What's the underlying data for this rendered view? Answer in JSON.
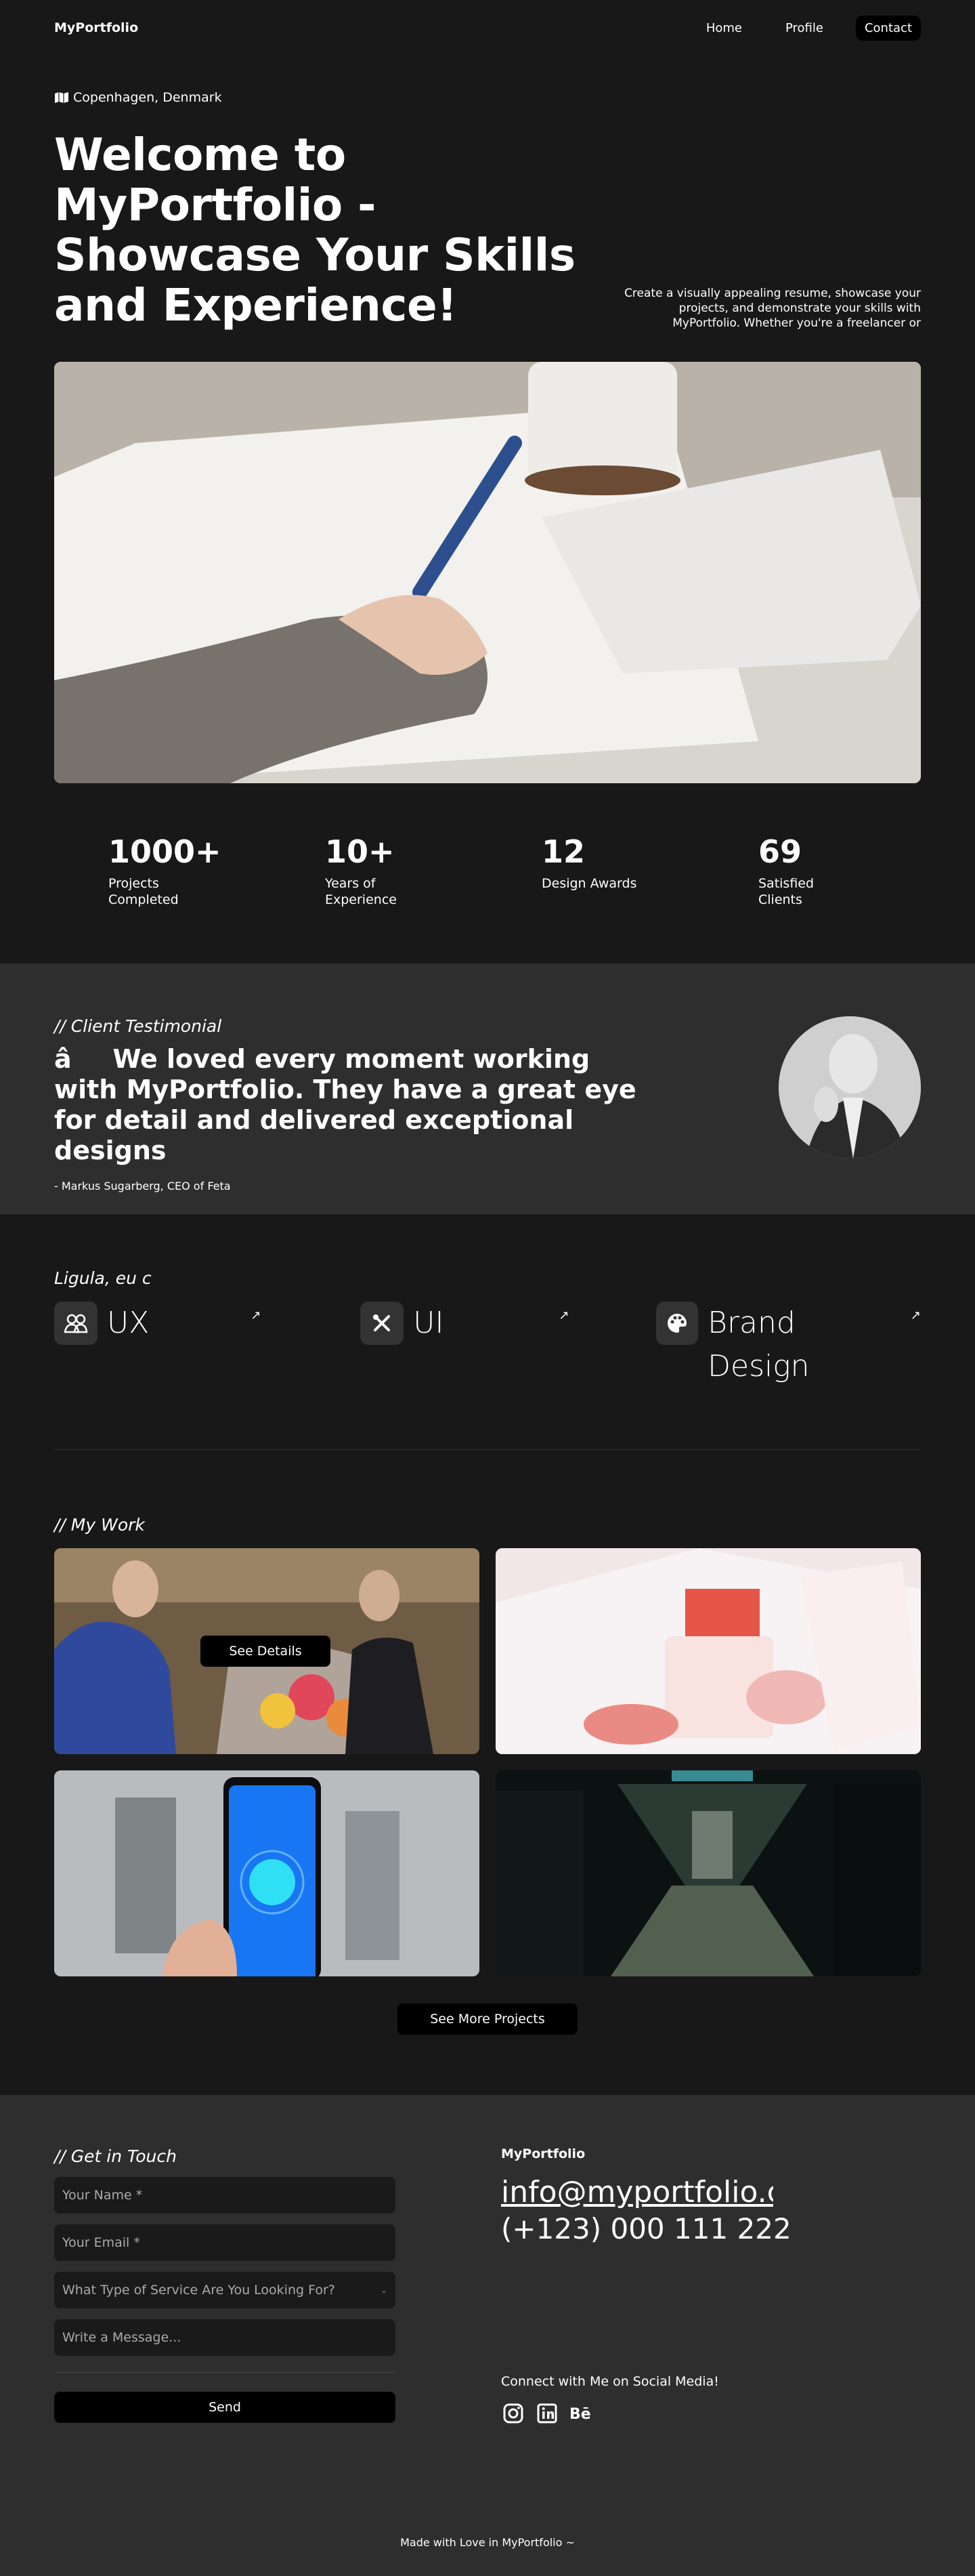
{
  "nav": {
    "logo": "MyPortfolio",
    "links": [
      "Home",
      "Profile"
    ],
    "contact": "Contact"
  },
  "hero": {
    "location_icon": "map-icon",
    "location": "Copenhagen, Denmark",
    "title": "Welcome to MyPortfolio - Showcase Your Skills and Experience!",
    "description": "Create a visually appealing resume, showcase your projects, and demonstrate your skills with MyPortfolio. Whether you're a freelancer or"
  },
  "stats": [
    {
      "value": "1000+",
      "label": "Projects Completed"
    },
    {
      "value": "10+",
      "label": "Years of Experience"
    },
    {
      "value": "12",
      "label": "Design Awards"
    },
    {
      "value": "69",
      "label": "Satisfied Clients"
    }
  ],
  "testimonial": {
    "tag": "// Client Testimonial",
    "quote": "âWe loved every moment working with MyPortfolio. They have a great eye for detail and delivered exceptional designs",
    "author": "- Markus Sugarberg, CEO of Feta"
  },
  "services": {
    "tag": "Ligula, eu c",
    "items": [
      {
        "icon": "users-icon",
        "name": "UX",
        "arrow": "↗"
      },
      {
        "icon": "tools-icon",
        "name": "UI",
        "arrow": "↗"
      },
      {
        "icon": "palette-icon",
        "name": "Brand Design",
        "arrow": "↗"
      }
    ]
  },
  "work": {
    "tag": "// My Work",
    "details_label": "See Details",
    "more_label": "See More Projects"
  },
  "contact": {
    "tag": "// Get in Touch",
    "name_placeholder": "Your Name *",
    "email_placeholder": "Your Email *",
    "service_placeholder": "What Type of Service Are You Looking For?",
    "message_placeholder": "Write a Message...",
    "send_label": "Send",
    "info_name": "MyPortfolio",
    "email": "info@myportfolio.com",
    "phone": "(+123) 000 111 222",
    "social_label": "Connect with Me on Social Media!",
    "social": [
      "instagram-icon",
      "linkedin-icon",
      "behance-icon"
    ]
  },
  "footer": {
    "text": "Made with Love in MyPortfolio ~"
  }
}
